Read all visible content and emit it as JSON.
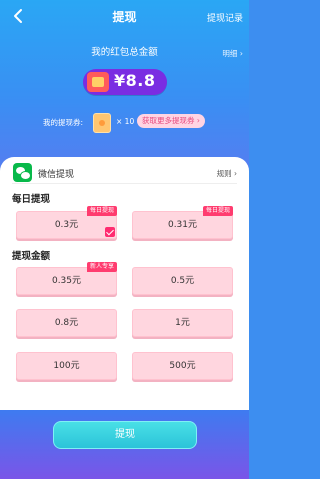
{
  "header": {
    "title": "提现",
    "record_label": "提现记录",
    "back_icon": "chevron-left-icon"
  },
  "summary": {
    "label": "我的红包总金额",
    "detail_label": "明细",
    "amount": "¥8.8",
    "wallet_icon": "wallet-icon"
  },
  "coupons": {
    "label": "我的提现券:",
    "count": "× 10",
    "get_more_label": "获取更多提现券"
  },
  "method": {
    "label": "微信提现",
    "rules_label": "规则",
    "icon": "wechat-icon"
  },
  "daily": {
    "title": "每日提现",
    "options": [
      {
        "label": "0.3元",
        "tag": "每日提现",
        "selected": true
      },
      {
        "label": "0.31元",
        "tag": "每日提现",
        "selected": false
      }
    ]
  },
  "amounts": {
    "title": "提现金额",
    "options": [
      {
        "label": "0.35元",
        "tag": "新人专享"
      },
      {
        "label": "0.5元"
      },
      {
        "label": "0.8元"
      },
      {
        "label": "1元"
      },
      {
        "label": "100元"
      },
      {
        "label": "500元"
      }
    ]
  },
  "footer": {
    "submit_label": "提现"
  },
  "colors": {
    "accent_pink": "#ff3c6f",
    "option_bg": "#ffd6df",
    "balance_pill": "#7a2de2",
    "submit_cyan": "#2bc3d9"
  }
}
